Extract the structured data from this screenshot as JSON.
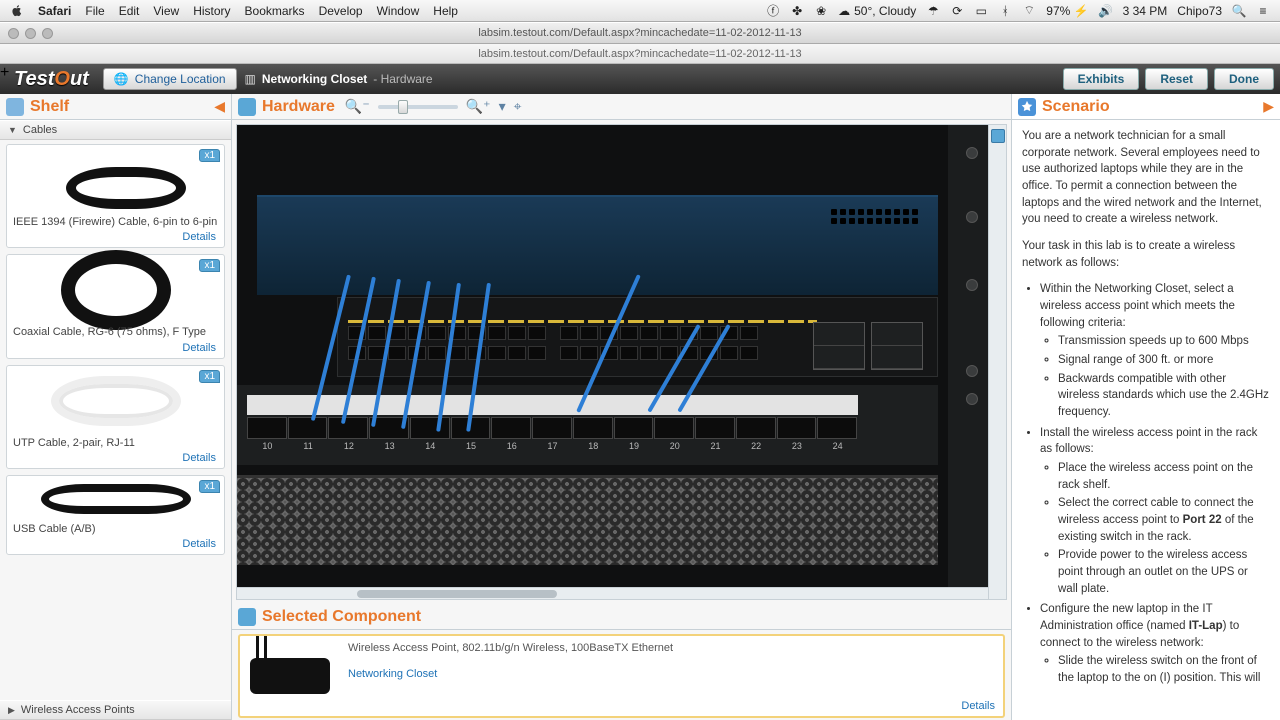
{
  "menubar": {
    "app": "Safari",
    "items": [
      "File",
      "Edit",
      "View",
      "History",
      "Bookmarks",
      "Develop",
      "Window",
      "Help"
    ],
    "weather": "50°, Cloudy",
    "battery": "97%",
    "time": "3 34 PM",
    "user": "Chipo73"
  },
  "window": {
    "title": "labsim.testout.com/Default.aspx?mincachedate=11-02-2012-11-13",
    "url": "labsim.testout.com/Default.aspx?mincachedate=11-02-2012-11-13"
  },
  "toolbar": {
    "change_location": "Change Location",
    "location": "Networking Closet",
    "sub": "- Hardware",
    "exhibits": "Exhibits",
    "reset": "Reset",
    "done": "Done"
  },
  "shelf": {
    "title": "Shelf",
    "section_cables": "Cables",
    "section_wap": "Wireless Access Points",
    "items": [
      {
        "name": "IEEE 1394 (Firewire) Cable, 6-pin to 6-pin",
        "qty": "x1",
        "details": "Details"
      },
      {
        "name": "Coaxial Cable, RG-6 (75 ohms), F Type",
        "qty": "x1",
        "details": "Details"
      },
      {
        "name": "UTP Cable, 2-pair, RJ-11",
        "qty": "x1",
        "details": "Details"
      },
      {
        "name": "USB Cable (A/B)",
        "qty": "x1",
        "details": "Details"
      }
    ]
  },
  "hardware": {
    "title": "Hardware"
  },
  "patch_numbers": [
    "10",
    "11",
    "12",
    "13",
    "14",
    "15",
    "16",
    "17",
    "18",
    "19",
    "20",
    "21",
    "22",
    "23",
    "24"
  ],
  "selected": {
    "title": "Selected Component",
    "name": "Wireless Access Point, 802.11b/g/n Wireless, 100BaseTX Ethernet",
    "location": "Networking Closet",
    "details": "Details"
  },
  "scenario": {
    "title": "Scenario",
    "p1": "You are a network technician for a small corporate network. Several employees need to use authorized laptops while they are in the office. To permit a connection between the laptops and the wired network and the Internet, you need to create a wireless network.",
    "p2": "Your task in this lab is to create a wireless network as follows:",
    "l1": "Within the Networking Closet, select a wireless access point which meets the following criteria:",
    "l1a": "Transmission speeds up to 600 Mbps",
    "l1b": "Signal range of 300 ft. or more",
    "l1c": "Backwards compatible with other wireless standards which use the 2.4GHz frequency.",
    "l2": "Install the wireless access point in the rack as follows:",
    "l2a": "Place the wireless access point on the rack shelf.",
    "l2b_pre": "Select the correct cable to connect the wireless access point to ",
    "l2b_bold": "Port 22",
    "l2b_post": " of the existing switch in the rack.",
    "l2c": "Provide power to the wireless access point through an outlet on the UPS or wall plate.",
    "l3_pre": "Configure the new laptop in the IT Administration office (named ",
    "l3_bold": "IT-Lap",
    "l3_post": ") to connect to the wireless network:",
    "l3a": "Slide the wireless switch on the front of the laptop to the on (I) position. This will"
  }
}
